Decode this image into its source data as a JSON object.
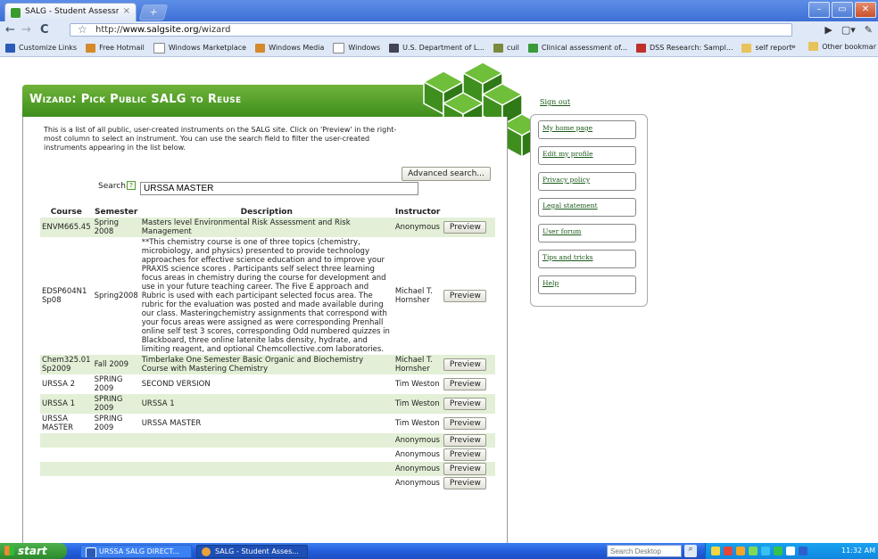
{
  "browser": {
    "tab_title": "SALG - Student Assessmen...",
    "tab_close": "×",
    "newtab": "+",
    "url_prefix": "http://",
    "url_host": "www.salgsite.org",
    "url_path": "/wizard",
    "window_buttons": [
      "–",
      "▭",
      "✕"
    ],
    "bookmarks": [
      {
        "label": "Customize Links",
        "icon": "customize-links-icon",
        "color": "#2a5bb8"
      },
      {
        "label": "Free Hotmail",
        "icon": "msn-icon",
        "color": "#d48a2a"
      },
      {
        "label": "Windows Marketplace",
        "icon": "page-icon",
        "color": "#ffffff"
      },
      {
        "label": "Windows Media",
        "icon": "msn-icon",
        "color": "#d48a2a"
      },
      {
        "label": "Windows",
        "icon": "page-icon",
        "color": "#ffffff"
      },
      {
        "label": "U.S. Department of L...",
        "icon": "seal-icon",
        "color": "#445"
      },
      {
        "label": "cuil",
        "icon": "cuil-icon",
        "color": "#7a8a3a"
      },
      {
        "label": "Clinical assessment of...",
        "icon": "people-icon",
        "color": "#3a9a3a"
      },
      {
        "label": "DSS Research: Sampl...",
        "icon": "dss-icon",
        "color": "#c0302a"
      },
      {
        "label": "self report",
        "icon": "folder-icon",
        "color": "#e8c25a"
      }
    ],
    "overflow_chevron": "»",
    "other_bookmarks": "Other bookmar"
  },
  "page": {
    "banner_title": "Wizard: Pick Public SALG to Reuse",
    "intro_text": "This is a list of all public, user-created instruments on the SALG site. Click on 'Preview' in the right-most column to select an instrument. You can use the search field to filter the user-created instruments appearing in the list below.",
    "advanced_search_label": "Advanced search...",
    "search_label": "Search",
    "search_help": "?",
    "search_value": "URSSA MASTER",
    "columns": [
      "Course",
      "Semester",
      "Description",
      "Instructor",
      ""
    ],
    "rows": [
      {
        "course": "ENVM665.45",
        "semester": "Spring 2008",
        "description": "Masters level Environmental Risk Assessment and Risk Management",
        "instructor": "Anonymous",
        "action": "Preview"
      },
      {
        "course": "EDSP604N1 Sp08",
        "semester": "Spring2008",
        "description": "**This chemistry course is one of three topics (chemistry, microbiology, and physics) presented to provide technology approaches for effective science education and to improve your PRAXIS science scores . Participants self select three learning focus areas in chemistry during the course for development and use in your future teaching career. The Five E approach and Rubric is used with each participant selected focus area. The rubric for the evaluation was posted and made available during our class. Masteringchemistry assignments that correspond with your focus areas were assigned as were corresponding Prenhall online self test 3 scores, corresponding Odd numbered quizzes in Blackboard, three online latenite labs density, hydrate, and limiting reagent, and optional Chemcollective.com laboratories.",
        "instructor": "Michael T. Hornsher",
        "action": "Preview"
      },
      {
        "course": "Chem325.01 Sp2009",
        "semester": "Fall 2009",
        "description": "Timberlake One Semester Basic Organic and Biochemistry Course with Mastering Chemistry",
        "instructor": "Michael T. Hornsher",
        "action": "Preview"
      },
      {
        "course": "URSSA 2",
        "semester": "SPRING 2009",
        "description": "SECOND VERSION",
        "instructor": "Tim Weston",
        "action": "Preview"
      },
      {
        "course": "URSSA 1",
        "semester": "SPRING 2009",
        "description": "URSSA 1",
        "instructor": "Tim Weston",
        "action": "Preview"
      },
      {
        "course": "URSSA MASTER",
        "semester": "SPRING 2009",
        "description": "URSSA MASTER",
        "instructor": "Tim Weston",
        "action": "Preview"
      },
      {
        "course": "",
        "semester": "",
        "description": "",
        "instructor": "Anonymous",
        "action": "Preview"
      },
      {
        "course": "",
        "semester": "",
        "description": "",
        "instructor": "Anonymous",
        "action": "Preview"
      },
      {
        "course": "",
        "semester": "",
        "description": "",
        "instructor": "Anonymous",
        "action": "Preview"
      },
      {
        "course": "",
        "semester": "",
        "description": "",
        "instructor": "Anonymous",
        "action": "Preview"
      }
    ],
    "sign_out": "Sign out",
    "sidebar_links": [
      "My home page",
      "Edit my profile",
      "Privacy policy",
      "Legal statement",
      "User forum",
      "Tips and tricks",
      "Help"
    ],
    "brand_color": "#4a9a26"
  },
  "taskbar": {
    "start_label": "start",
    "tasks": [
      {
        "label": "URSSA SALG DIRECT...",
        "icon": "word-doc-icon",
        "color": "#2a5bb8"
      },
      {
        "label": "SALG - Student Asses...",
        "icon": "chrome-icon",
        "color": "#e8a23a"
      }
    ],
    "search_placeholder": "Search Desktop",
    "search_go": "⌕",
    "clock": "11:32 AM"
  }
}
